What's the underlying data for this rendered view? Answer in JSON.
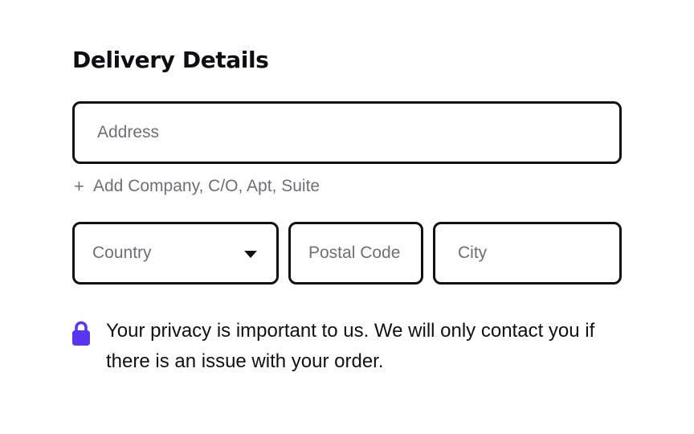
{
  "form": {
    "title": "Delivery Details",
    "address": {
      "placeholder": "Address",
      "value": ""
    },
    "add_line": {
      "icon": "plus-icon",
      "label": "Add Company, C/O, Apt, Suite"
    },
    "country": {
      "placeholder": "Country",
      "icon": "caret-down-icon"
    },
    "postal_code": {
      "placeholder": "Postal Code",
      "value": ""
    },
    "city": {
      "placeholder": "City",
      "value": ""
    },
    "privacy_notice": {
      "icon": "lock-icon",
      "text": "Your privacy is important to us. We will only contact you if there is an issue with your order."
    }
  },
  "colors": {
    "text": "#111111",
    "placeholder": "#6f6f76",
    "border": "#111111",
    "lock": "#5b36f0",
    "background": "#ffffff"
  }
}
